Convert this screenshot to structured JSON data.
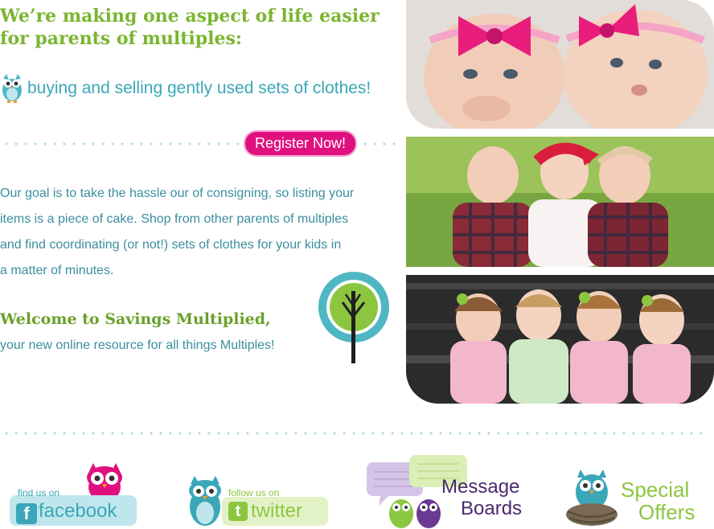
{
  "hero": {
    "headline_line1": "We’re making one aspect of life easier",
    "headline_line2": "for parents of multiples:",
    "tagline": "buying and selling gently used sets of clothes!"
  },
  "register": {
    "label": "Register Now!"
  },
  "goal": {
    "line1": "Our goal is to take the hassle our of consigning, so listing your",
    "line2": "items is a piece of cake. Shop from other parents of multiples",
    "line3": "and find coordinating (or not!) sets of clothes for your kids in",
    "line4": "a matter of minutes."
  },
  "welcome": {
    "title": "Welcome to Savings Multiplied,",
    "subtitle": "your new online resource for all things Multiples!"
  },
  "footer": {
    "facebook": {
      "prefix": "find us on",
      "name": "facebook",
      "badge_letter": "f"
    },
    "twitter": {
      "prefix": "follow us on",
      "name": "twitter",
      "badge_letter": "t"
    },
    "message_boards": {
      "line1": "Message",
      "line2": "Boards"
    },
    "special_offers": {
      "line1": "Special",
      "line2": "Offers"
    }
  },
  "colors": {
    "headline_green": "#7ab530",
    "teal": "#3aa7b9",
    "pink": "#e0117f",
    "purple": "#4b2a6e",
    "dots": "#a9dbe3"
  },
  "icons": {
    "tagline": "owl-icon",
    "tree": "tree-logo-icon",
    "facebook": "owl-pink-icon",
    "twitter": "owl-teal-icon",
    "message_boards": "speech-bubbles-owls-icon",
    "special_offers": "owl-nest-icon"
  }
}
